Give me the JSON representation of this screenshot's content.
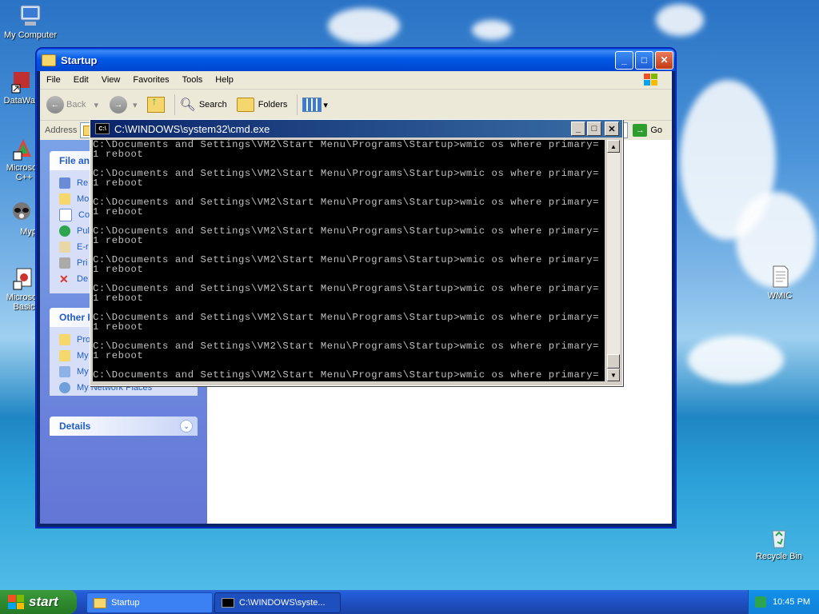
{
  "desktop": {
    "icons": [
      {
        "label": "My Computer"
      },
      {
        "label": "DataWa"
      },
      {
        "label": "Microsoft C++"
      },
      {
        "label": "Myp"
      },
      {
        "label": "Microsoft Basic"
      },
      {
        "label": "WMIC"
      },
      {
        "label": "Recycle Bin"
      }
    ]
  },
  "explorer": {
    "title": "Startup",
    "menu": [
      "File",
      "Edit",
      "View",
      "Favorites",
      "Tools",
      "Help"
    ],
    "toolbar": {
      "back": "Back",
      "search": "Search",
      "folders": "Folders"
    },
    "address_label": "Address",
    "go_label": "Go",
    "tasks_panel": {
      "title": "File an",
      "items": [
        "Re",
        "Mo",
        "Co",
        "Pul",
        "E-r",
        "Pri",
        "De"
      ]
    },
    "other_panel": {
      "title": "Other I",
      "items": [
        "Pro",
        "My",
        "My",
        "My Network Places"
      ]
    },
    "details_panel": {
      "title": "Details"
    }
  },
  "cmd": {
    "title": "C:\\WINDOWS\\system32\\cmd.exe",
    "icon_text": "C:\\",
    "lines": [
      "C:\\Documents and Settings\\VM2\\Start Menu\\Programs\\Startup>wmic os where primary=",
      "1 reboot",
      "",
      "C:\\Documents and Settings\\VM2\\Start Menu\\Programs\\Startup>wmic os where primary=",
      "1 reboot",
      "",
      "C:\\Documents and Settings\\VM2\\Start Menu\\Programs\\Startup>wmic os where primary=",
      "1 reboot",
      "",
      "C:\\Documents and Settings\\VM2\\Start Menu\\Programs\\Startup>wmic os where primary=",
      "1 reboot",
      "",
      "C:\\Documents and Settings\\VM2\\Start Menu\\Programs\\Startup>wmic os where primary=",
      "1 reboot",
      "",
      "C:\\Documents and Settings\\VM2\\Start Menu\\Programs\\Startup>wmic os where primary=",
      "1 reboot",
      "",
      "C:\\Documents and Settings\\VM2\\Start Menu\\Programs\\Startup>wmic os where primary=",
      "1 reboot",
      "",
      "C:\\Documents and Settings\\VM2\\Start Menu\\Programs\\Startup>wmic os where primary=",
      "1 reboot",
      "",
      "C:\\Documents and Settings\\VM2\\Start Menu\\Programs\\Startup>wmic os where primary="
    ]
  },
  "taskbar": {
    "start_label": "start",
    "items": [
      {
        "label": "Startup"
      },
      {
        "label": "C:\\WINDOWS\\syste..."
      }
    ],
    "clock": "10:45 PM"
  }
}
